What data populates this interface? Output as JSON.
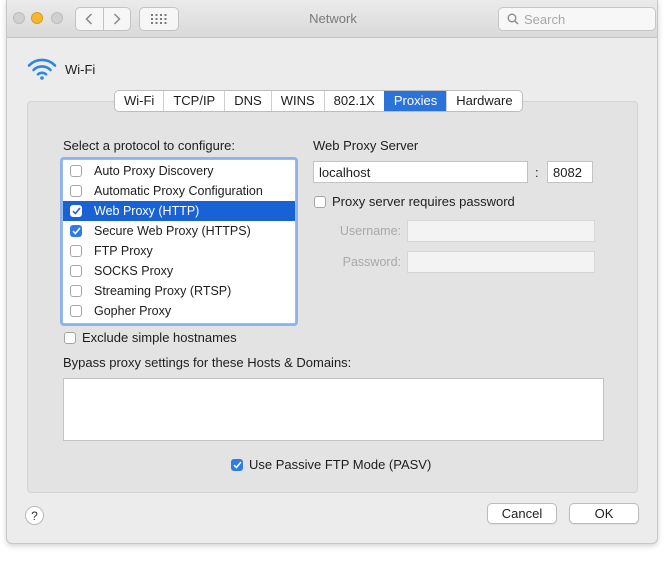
{
  "window": {
    "title": "Network"
  },
  "toolbar": {
    "search_placeholder": "Search"
  },
  "header": {
    "interface_name": "Wi-Fi"
  },
  "tabs": [
    {
      "label": "Wi-Fi",
      "active": false
    },
    {
      "label": "TCP/IP",
      "active": false
    },
    {
      "label": "DNS",
      "active": false
    },
    {
      "label": "WINS",
      "active": false
    },
    {
      "label": "802.1X",
      "active": false
    },
    {
      "label": "Proxies",
      "active": true
    },
    {
      "label": "Hardware",
      "active": false
    }
  ],
  "protocols": {
    "heading": "Select a protocol to configure:",
    "items": [
      {
        "label": "Auto Proxy Discovery",
        "checked": false,
        "selected": false
      },
      {
        "label": "Automatic Proxy Configuration",
        "checked": false,
        "selected": false
      },
      {
        "label": "Web Proxy (HTTP)",
        "checked": true,
        "selected": true
      },
      {
        "label": "Secure Web Proxy (HTTPS)",
        "checked": true,
        "selected": false
      },
      {
        "label": "FTP Proxy",
        "checked": false,
        "selected": false
      },
      {
        "label": "SOCKS Proxy",
        "checked": false,
        "selected": false
      },
      {
        "label": "Streaming Proxy (RTSP)",
        "checked": false,
        "selected": false
      },
      {
        "label": "Gopher Proxy",
        "checked": false,
        "selected": false
      }
    ]
  },
  "proxy_server": {
    "heading": "Web Proxy Server",
    "host": "localhost",
    "separator": ":",
    "port": "8082",
    "requires_password_label": "Proxy server requires password",
    "requires_password": false,
    "username_label": "Username:",
    "username": "",
    "password_label": "Password:",
    "password": ""
  },
  "exclude_simple_hostnames": {
    "label": "Exclude simple hostnames",
    "checked": false
  },
  "bypass": {
    "label": "Bypass proxy settings for these Hosts & Domains:",
    "value": ""
  },
  "passive_ftp": {
    "label": "Use Passive FTP Mode (PASV)",
    "checked": true
  },
  "buttons": {
    "help": "?",
    "cancel": "Cancel",
    "ok": "OK"
  },
  "colors": {
    "accent": "#2c73d9",
    "selection": "#1862d6",
    "window_bg": "#ececec",
    "panel_bg": "#e3e3e3"
  }
}
